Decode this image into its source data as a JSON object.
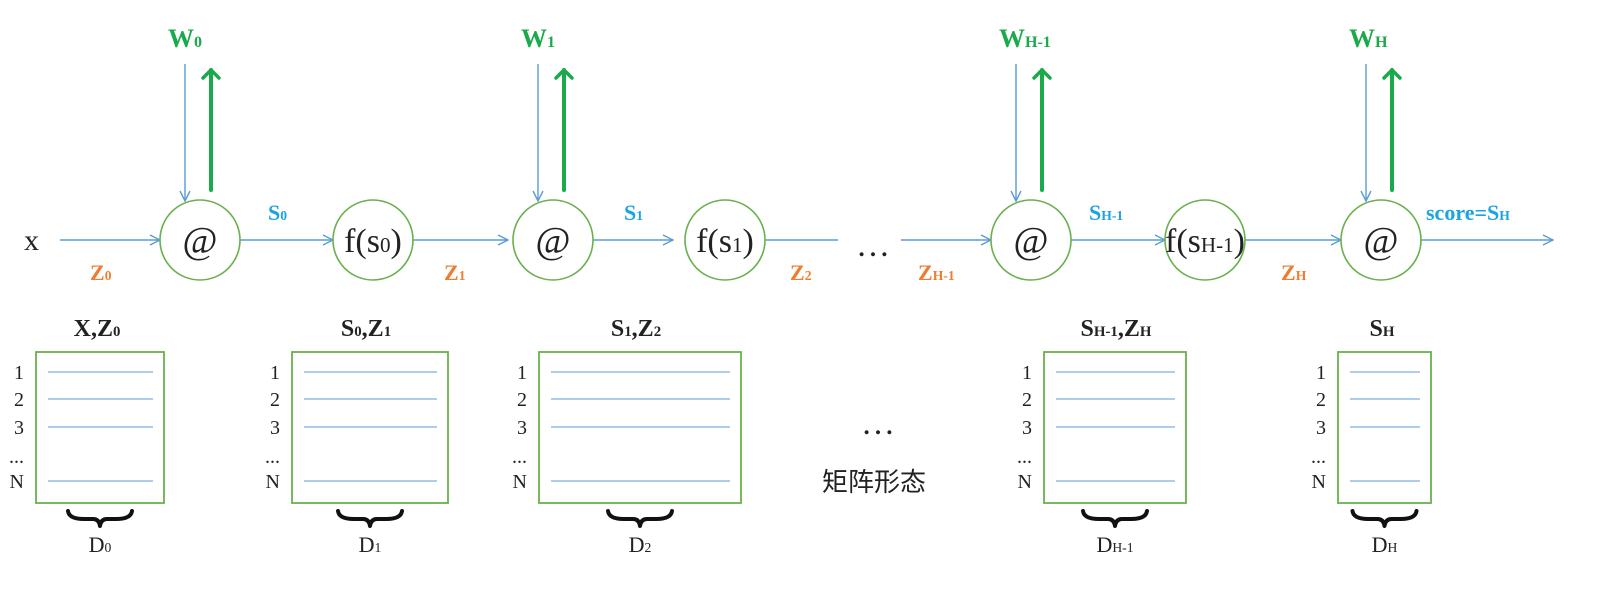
{
  "input": {
    "base": "x"
  },
  "weights": [
    {
      "base": "W",
      "sub": "0"
    },
    {
      "base": "W",
      "sub": "1"
    },
    {
      "base": "W",
      "sub": "H-1"
    },
    {
      "base": "W",
      "sub": "H"
    }
  ],
  "nodes": [
    {
      "kind": "matmul",
      "text": "@"
    },
    {
      "kind": "activation",
      "text": "f(s",
      "sub": "0",
      "close": ")"
    },
    {
      "kind": "matmul",
      "text": "@"
    },
    {
      "kind": "activation",
      "text": "f(s",
      "sub": "1",
      "close": ")"
    },
    {
      "kind": "matmul",
      "text": "@"
    },
    {
      "kind": "activation",
      "text": "f(s",
      "sub": "H-1",
      "close": ")"
    },
    {
      "kind": "matmul",
      "text": "@"
    }
  ],
  "s_labels": [
    {
      "base": "S",
      "sub": "0"
    },
    {
      "base": "S",
      "sub": "1"
    },
    {
      "base": "S",
      "sub": "H-1"
    }
  ],
  "output_label": {
    "base": "score=S",
    "sub": "H"
  },
  "z_labels": [
    {
      "base": "Z",
      "sub": "0"
    },
    {
      "base": "Z",
      "sub": "1"
    },
    {
      "base": "Z",
      "sub": "2"
    },
    {
      "base": "Z",
      "sub": "H-1"
    },
    {
      "base": "Z",
      "sub": "H"
    }
  ],
  "ellipsis": "…",
  "matrices": [
    {
      "title": [
        {
          "base": "X",
          "sub": ""
        },
        {
          "base": ",",
          "sub": ""
        },
        {
          "base": "Z",
          "sub": "0"
        }
      ],
      "dim": {
        "base": "D",
        "sub": "0"
      }
    },
    {
      "title": [
        {
          "base": "S",
          "sub": "0"
        },
        {
          "base": ",",
          "sub": ""
        },
        {
          "base": "Z",
          "sub": "1"
        }
      ],
      "dim": {
        "base": "D",
        "sub": "1"
      }
    },
    {
      "title": [
        {
          "base": "S",
          "sub": "1"
        },
        {
          "base": ",",
          "sub": ""
        },
        {
          "base": "Z",
          "sub": "2"
        }
      ],
      "dim": {
        "base": "D",
        "sub": "2"
      }
    },
    {
      "title": [
        {
          "base": "S",
          "sub": "H-1"
        },
        {
          "base": ",",
          "sub": ""
        },
        {
          "base": "Z",
          "sub": "H"
        }
      ],
      "dim": {
        "base": "D",
        "sub": "H-1"
      }
    },
    {
      "title": [
        {
          "base": "S",
          "sub": "H"
        }
      ],
      "dim": {
        "base": "D",
        "sub": "H"
      }
    }
  ],
  "row_labels": [
    "1",
    "2",
    "3",
    "...",
    "N"
  ],
  "matrix_ellipsis": "…",
  "matrix_caption": "矩阵形态",
  "colors": {
    "weight": "#1aaa4b",
    "s_label": "#1aa4e0",
    "z_label": "#ef7d31",
    "node_stroke": "#6ab04c",
    "matrix_stroke": "#6ab04c",
    "thin_arrow": "#5b9bd5",
    "thick_arrow": "#1aaa4b"
  }
}
